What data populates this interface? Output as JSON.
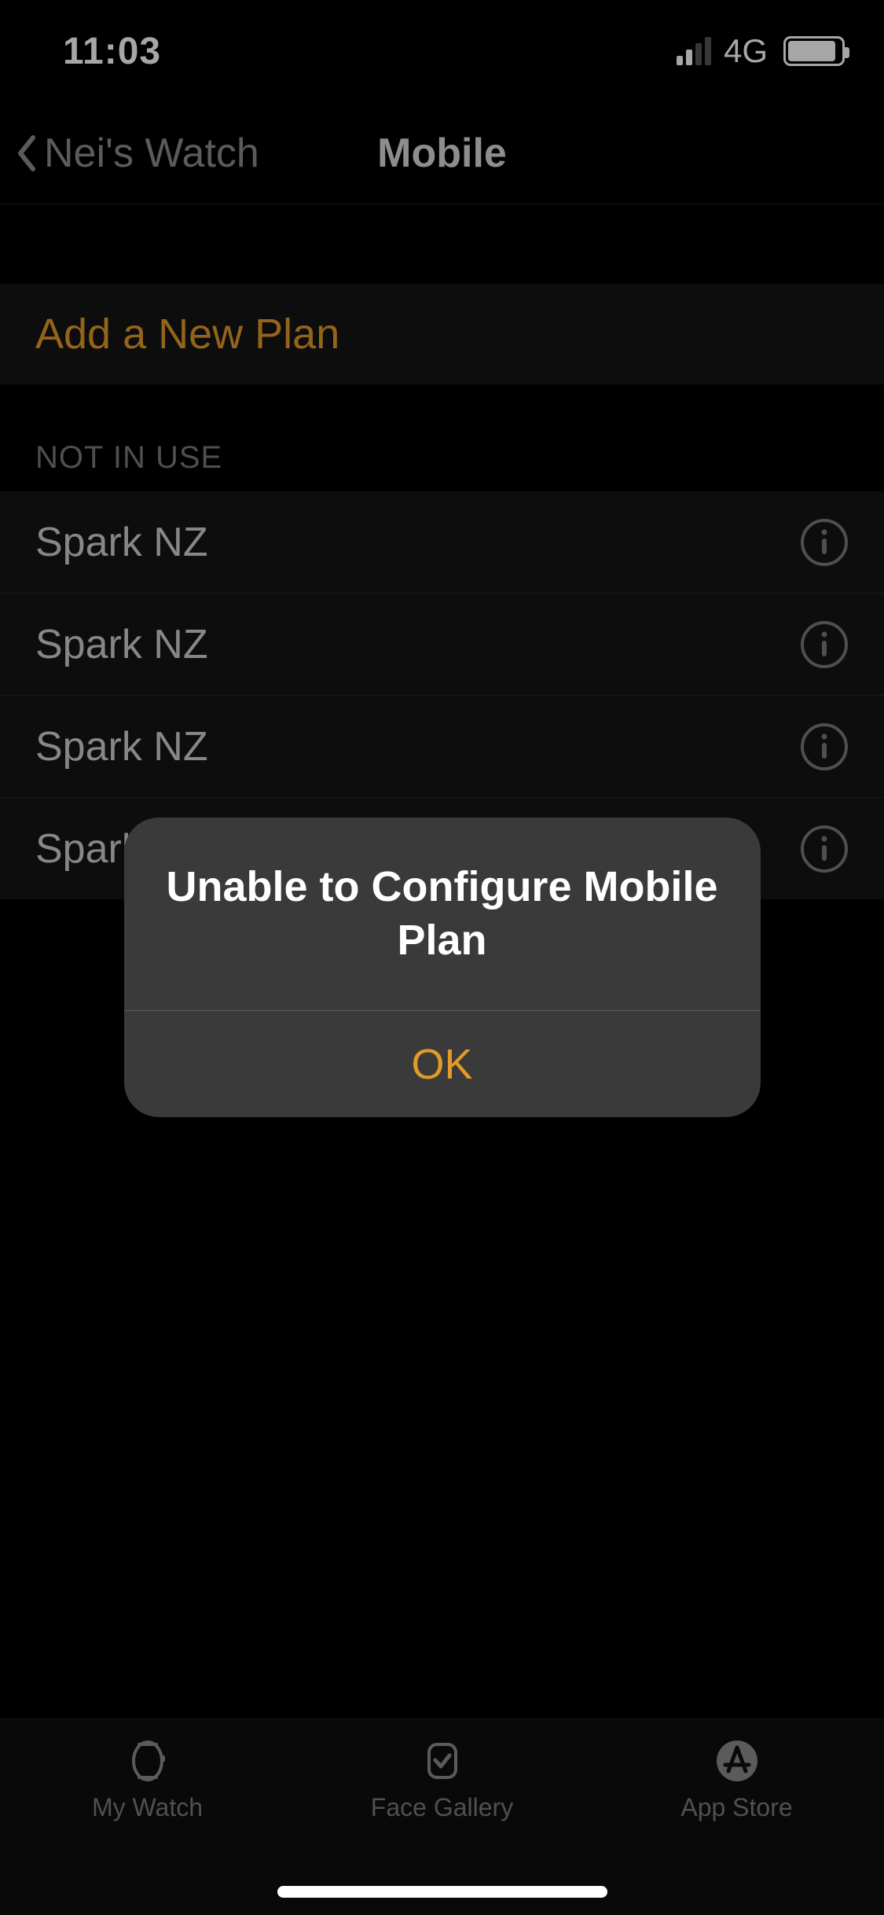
{
  "status": {
    "time": "11:03",
    "network": "4G"
  },
  "nav": {
    "back_label": "Nei's Watch",
    "title": "Mobile"
  },
  "actions": {
    "add_plan": "Add a New Plan"
  },
  "sections": {
    "not_in_use_header": "NOT IN USE",
    "plans": [
      {
        "label": "Spark NZ"
      },
      {
        "label": "Spark NZ"
      },
      {
        "label": "Spark NZ"
      },
      {
        "label": "Spark NZ"
      }
    ]
  },
  "alert": {
    "title": "Unable to Configure Mobile Plan",
    "ok": "OK"
  },
  "tabs": {
    "my_watch": "My Watch",
    "face_gallery": "Face Gallery",
    "app_store": "App Store"
  },
  "colors": {
    "accent": "#e29a28",
    "background": "#000000",
    "row": "#141414",
    "alert": "#3a3a3a"
  }
}
